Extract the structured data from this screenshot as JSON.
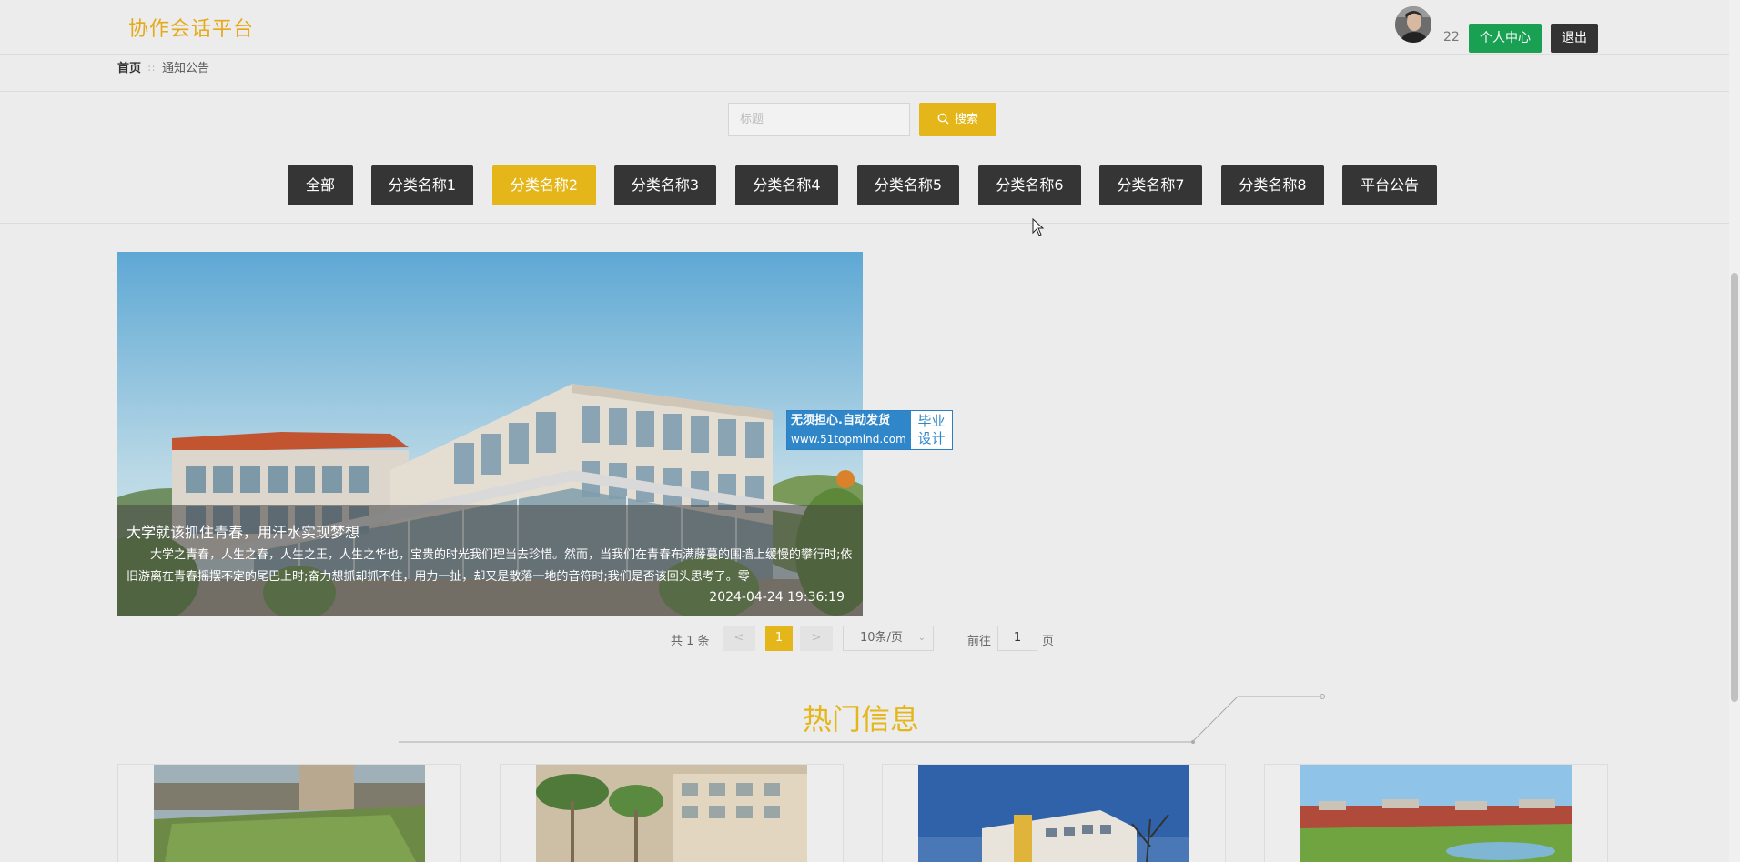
{
  "header": {
    "logo": "协作会话平台",
    "user_count": "22",
    "personal_center_label": "个人中心",
    "logout_label": "退出"
  },
  "breadcrumb": {
    "home": "首页",
    "separator": "∷",
    "current": "通知公告"
  },
  "search": {
    "placeholder": "标题",
    "button_label": "搜索"
  },
  "tabs": [
    {
      "label": "全部",
      "active": false
    },
    {
      "label": "分类名称1",
      "active": false
    },
    {
      "label": "分类名称2",
      "active": true
    },
    {
      "label": "分类名称3",
      "active": false
    },
    {
      "label": "分类名称4",
      "active": false
    },
    {
      "label": "分类名称5",
      "active": false
    },
    {
      "label": "分类名称6",
      "active": false
    },
    {
      "label": "分类名称7",
      "active": false
    },
    {
      "label": "分类名称8",
      "active": false
    },
    {
      "label": "平台公告",
      "active": false
    }
  ],
  "feature": {
    "title": "大学就该抓住青春，用汗水实现梦想",
    "description": "大学之青春，人生之春，人生之王，人生之华也，宝贵的时光我们理当去珍惜。然而，当我们在青春布满藤蔓的围墙上缓慢的攀行时;依旧游离在青春摇摆不定的尾巴上时;奋力想抓却抓不住，用力一扯，却又是散落一地的音符时;我们是否该回头思考了。零",
    "date": "2024-04-24 19:36:19"
  },
  "watermark": {
    "line1": "无须担心.自动发货",
    "line2": "www.51topmind.com",
    "right1": "毕业",
    "right2": "设计"
  },
  "pagination": {
    "total": "共 1 条",
    "prev": "<",
    "current_page": "1",
    "next": ">",
    "page_size": "10条/页",
    "goto_label": "前往",
    "goto_value": "1",
    "page_unit": "页"
  },
  "hot": {
    "title": "热门信息"
  },
  "colors": {
    "accent": "#e5b61a",
    "logo": "#e5a91a",
    "green": "#1aa052",
    "dark": "#353535"
  }
}
